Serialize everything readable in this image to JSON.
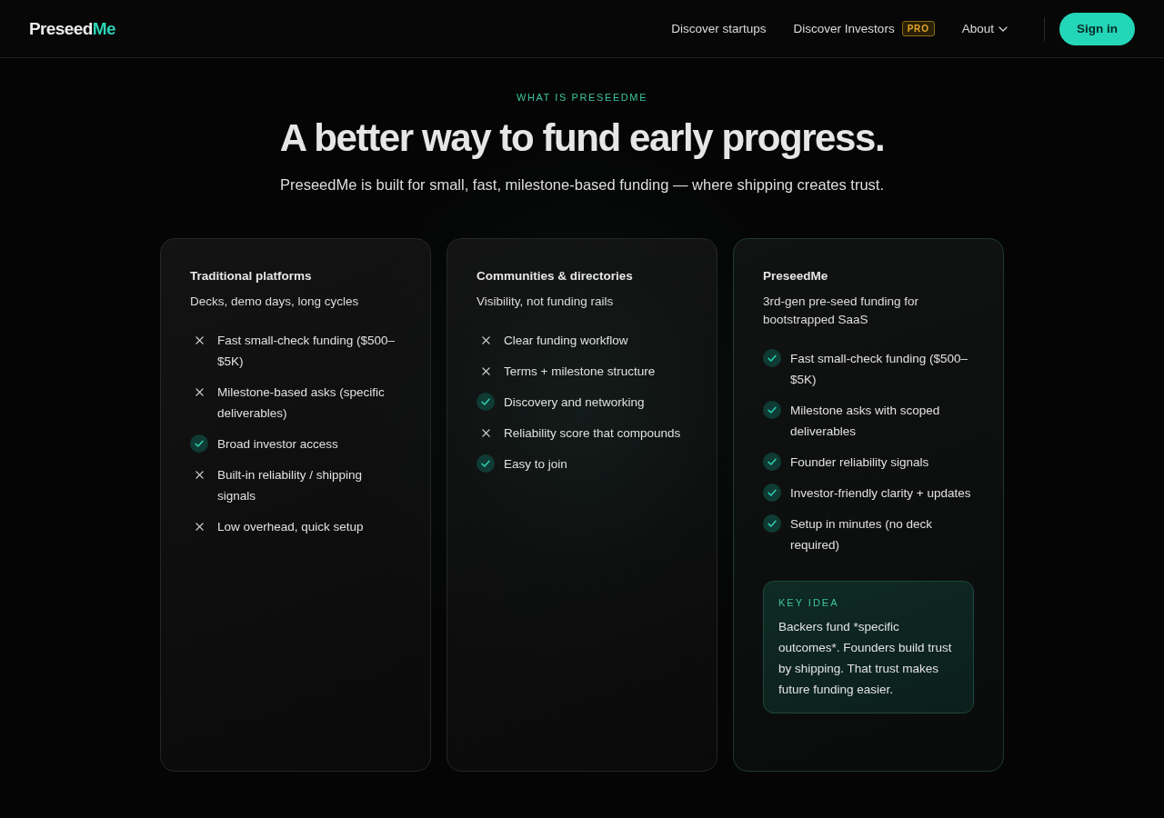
{
  "header": {
    "logo": {
      "text": "Preseed",
      "accent": "Me"
    },
    "nav": [
      {
        "label": "Discover startups",
        "dropdown": false
      },
      {
        "label": "Discover Investors",
        "badge": "PRO",
        "dropdown": false
      },
      {
        "label": "About",
        "dropdown": true
      }
    ],
    "sign_in": "Sign in"
  },
  "hero": {
    "eyebrow": "WHAT IS PRESEEDME",
    "title": "A better way to fund early progress.",
    "subtitle": "PreseedMe is built for small, fast, milestone-based funding — where shipping creates trust."
  },
  "cards": [
    {
      "title": "Traditional platforms",
      "subtitle": "Decks, demo days, long cycles",
      "highlighted": false,
      "items": [
        {
          "text": "Fast small-check funding ($500–$5K)",
          "included": false
        },
        {
          "text": "Milestone-based asks (specific deliverables)",
          "included": false
        },
        {
          "text": "Broad investor access",
          "included": true
        },
        {
          "text": "Built-in reliability / shipping signals",
          "included": false
        },
        {
          "text": "Low overhead, quick setup",
          "included": false
        }
      ]
    },
    {
      "title": "Communities & directories",
      "subtitle": "Visibility, not funding rails",
      "highlighted": false,
      "items": [
        {
          "text": "Clear funding workflow",
          "included": false
        },
        {
          "text": "Terms + milestone structure",
          "included": false
        },
        {
          "text": "Discovery and networking",
          "included": true
        },
        {
          "text": "Reliability score that compounds",
          "included": false
        },
        {
          "text": "Easy to join",
          "included": true
        }
      ]
    },
    {
      "title": "PreseedMe",
      "subtitle": "3rd-gen pre-seed funding for bootstrapped SaaS",
      "highlighted": true,
      "items": [
        {
          "text": "Fast small-check funding ($500–$5K)",
          "included": true
        },
        {
          "text": "Milestone asks with scoped deliverables",
          "included": true
        },
        {
          "text": "Founder reliability signals",
          "included": true
        },
        {
          "text": "Investor-friendly clarity + updates",
          "included": true
        },
        {
          "text": "Setup in minutes (no deck required)",
          "included": true
        }
      ],
      "key_idea": {
        "label": "KEY IDEA",
        "text": "Backers fund *specific outcomes*. Founders build trust by shipping. That trust makes future funding easier."
      }
    }
  ]
}
